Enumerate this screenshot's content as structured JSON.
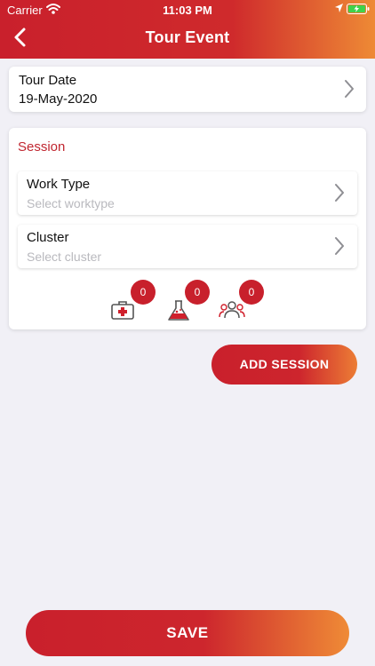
{
  "status_bar": {
    "carrier": "Carrier",
    "time": "11:03 PM",
    "icons": [
      "wifi-icon",
      "location-arrow-icon",
      "battery-charging-icon"
    ]
  },
  "header": {
    "title": "Tour Event",
    "back_icon": "chevron-left-icon"
  },
  "tour_date": {
    "label": "Tour Date",
    "value": "19-May-2020"
  },
  "session": {
    "title": "Session",
    "work_type": {
      "label": "Work Type",
      "placeholder": "Select worktype"
    },
    "cluster": {
      "label": "Cluster",
      "placeholder": "Select cluster"
    },
    "counters": [
      {
        "icon": "first-aid-kit-icon",
        "count": "0"
      },
      {
        "icon": "lab-flask-icon",
        "count": "0"
      },
      {
        "icon": "group-people-icon",
        "count": "0"
      }
    ]
  },
  "buttons": {
    "add_session": "ADD SESSION",
    "save": "SAVE"
  },
  "colors": {
    "brand_red": "#c9202c",
    "brand_orange": "#ee8a35",
    "background": "#f1f0f6",
    "session_title": "#c02630"
  }
}
